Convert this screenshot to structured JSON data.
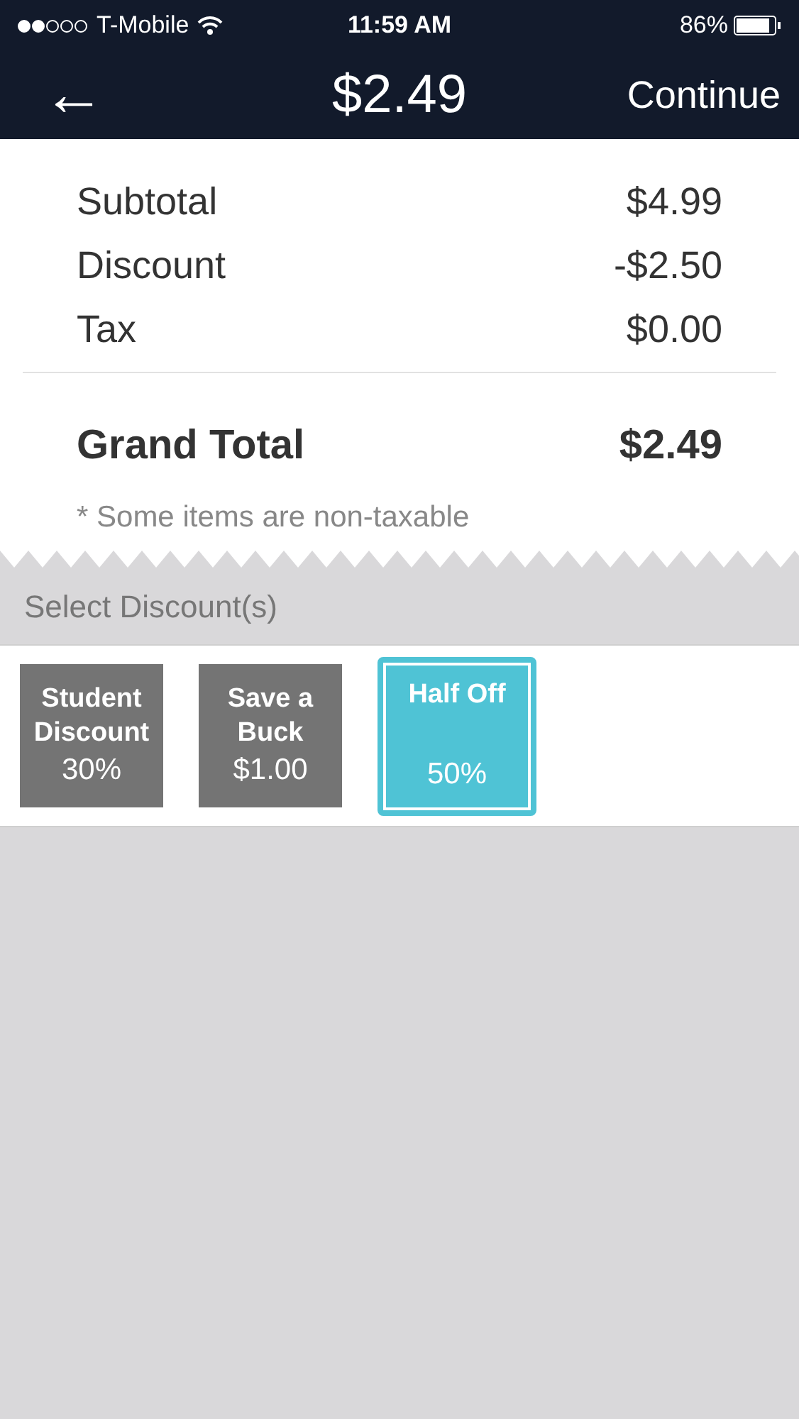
{
  "status_bar": {
    "carrier": "T-Mobile",
    "time": "11:59 AM",
    "battery": "86%"
  },
  "header": {
    "back": "←",
    "title": "$2.49",
    "action": "Continue"
  },
  "summary": [
    {
      "label": "Subtotal",
      "value": "$4.99"
    },
    {
      "label": "Discount",
      "value": "-$2.50"
    },
    {
      "label": "Tax",
      "value": "$0.00"
    }
  ],
  "grand_total": {
    "label": "Grand Total",
    "value": "$2.49"
  },
  "note": "* Some items are non-taxable",
  "discounts_heading": "Select Discount(s)",
  "discounts": [
    {
      "name": "Student Discount",
      "value": "30%",
      "selected": false
    },
    {
      "name": "Save a Buck",
      "value": "$1.00",
      "selected": false
    },
    {
      "name": "Half Off",
      "value": "50%",
      "selected": true
    }
  ]
}
